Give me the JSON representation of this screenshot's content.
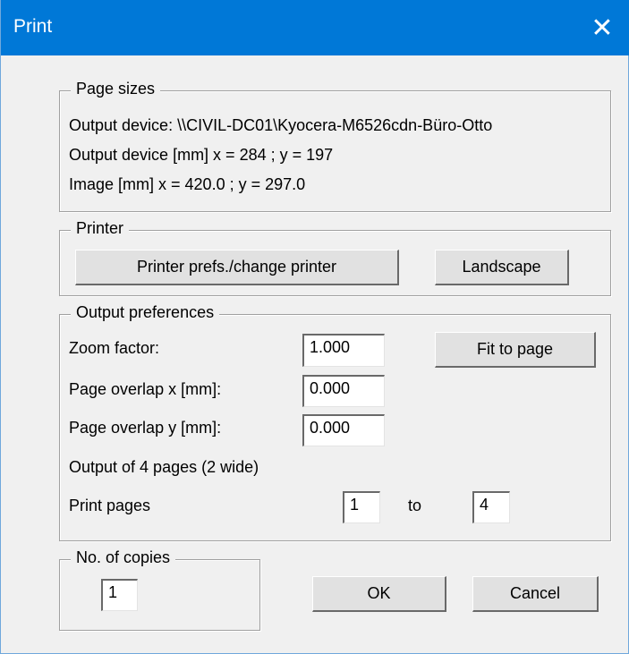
{
  "window": {
    "title": "Print",
    "close_glyph": "✕"
  },
  "page_sizes": {
    "legend": "Page sizes",
    "output_device": "Output device: \\\\CIVIL-DC01\\Kyocera-M6526cdn-Büro-Otto",
    "output_device_mm": "Output device [mm]  x = 284 ; y = 197",
    "image_mm": "Image [mm]  x = 420.0 ; y = 297.0"
  },
  "printer": {
    "legend": "Printer",
    "prefs_button": "Printer prefs./change printer",
    "orientation_button": "Landscape"
  },
  "output_preferences": {
    "legend": "Output preferences",
    "zoom_label": "Zoom factor:",
    "zoom_value": "1.000",
    "fit_button": "Fit to page",
    "overlap_x_label": "Page overlap x [mm]:",
    "overlap_x_value": "0.000",
    "overlap_y_label": "Page overlap y [mm]:",
    "overlap_y_value": "0.000",
    "pages_info": "Output of 4 pages (2 wide)",
    "print_pages_label": "Print pages",
    "from_value": "1",
    "to_label": "to",
    "to_value": "4"
  },
  "copies": {
    "legend": "No. of copies",
    "value": "1"
  },
  "actions": {
    "ok": "OK",
    "cancel": "Cancel"
  },
  "colors": {
    "titlebar": "#0078d7",
    "dialog_bg": "#f0f0f0",
    "button_bg": "#e1e1e1"
  }
}
